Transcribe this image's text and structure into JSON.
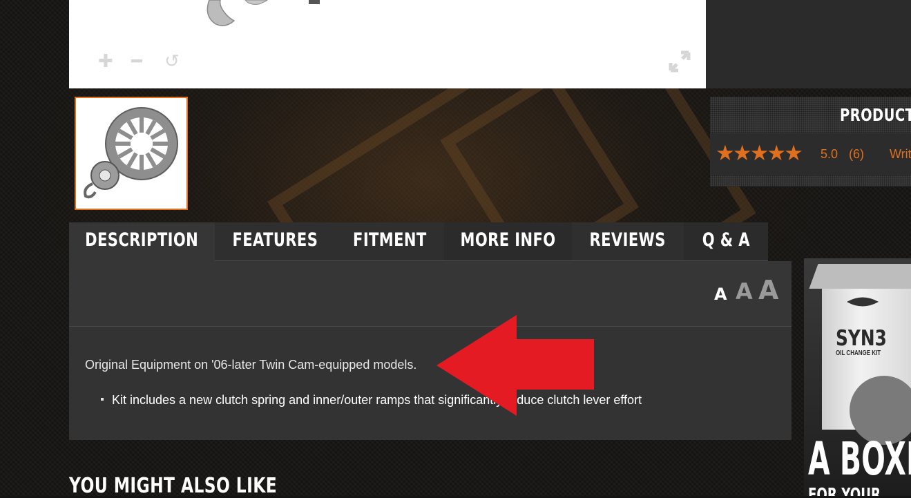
{
  "viewer": {
    "zoom_in_icon": "plus-icon",
    "zoom_out_icon": "minus-icon",
    "reset_icon": "rotate-icon",
    "fullscreen_icon": "expand-icon"
  },
  "product_panel": {
    "title": "PRODUCT",
    "stars": "★★★★★",
    "rating": "5.0",
    "review_count": "(6)",
    "write_review": "Writ"
  },
  "tabs": [
    {
      "label": "DESCRIPTION"
    },
    {
      "label": "FEATURES"
    },
    {
      "label": "FITMENT"
    },
    {
      "label": "MORE INFO"
    },
    {
      "label": "REVIEWS"
    },
    {
      "label": "Q & A"
    }
  ],
  "font_size": {
    "small": "A",
    "medium": "A",
    "large": "A"
  },
  "description": {
    "text": "Original Equipment on '06-later Twin Cam-equipped models.",
    "bullets": [
      "Kit includes a new clutch spring and inner/outer ramps that significantly reduce clutch lever effort"
    ]
  },
  "also_like": {
    "heading": "YOU MIGHT ALSO LIKE"
  },
  "ad": {
    "brand": "SYN3",
    "sub": "OIL CHANGE KIT",
    "headline": "A BOXE",
    "headline2": "FOR YOUR"
  },
  "colors": {
    "accent": "#e0701e",
    "arrow": "#e41b23",
    "panel": "#333333"
  }
}
